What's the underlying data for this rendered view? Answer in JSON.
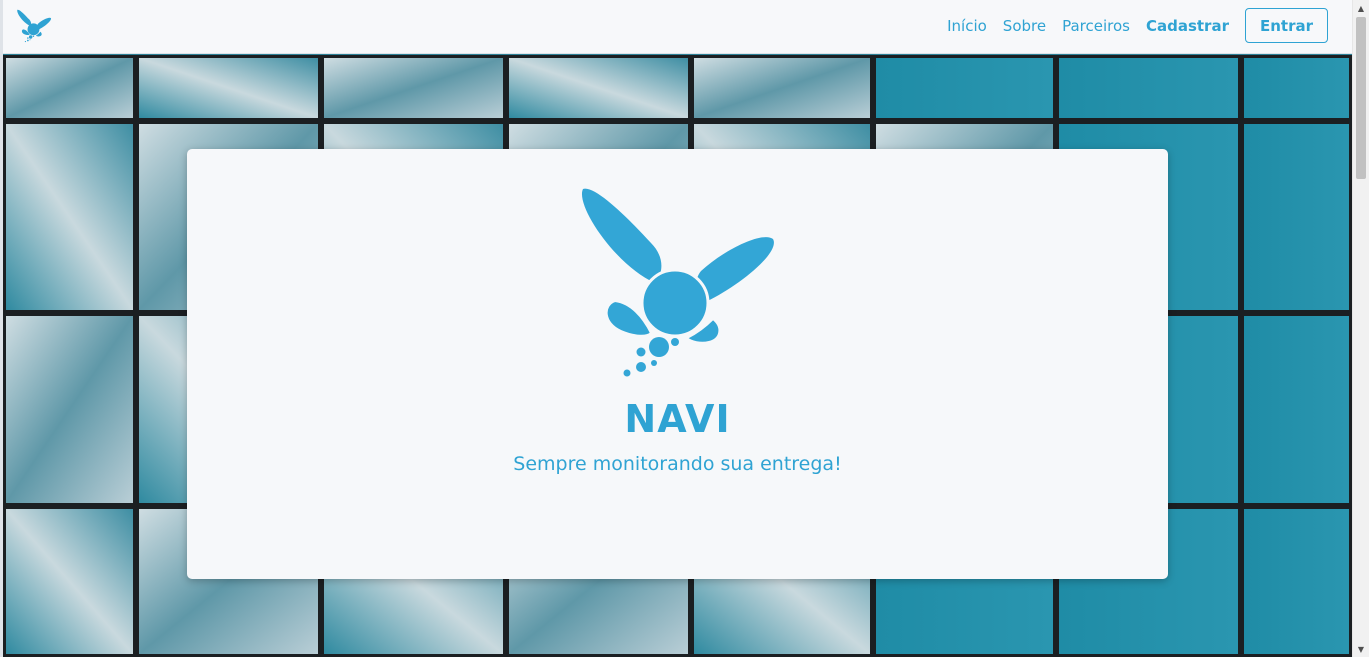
{
  "nav": {
    "brand_icon": "fairy-logo-icon",
    "links": [
      "Início",
      "Sobre",
      "Parceiros",
      "Cadastrar"
    ],
    "login_label": "Entrar"
  },
  "hero": {
    "logo_icon": "fairy-logo-icon",
    "title": "NAVI",
    "subtitle": "Sempre monitorando sua entrega!"
  },
  "colors": {
    "accent": "#2fa3d3",
    "navbar_bg": "#f7f8fa",
    "card_bg": "#f6f8fa"
  }
}
